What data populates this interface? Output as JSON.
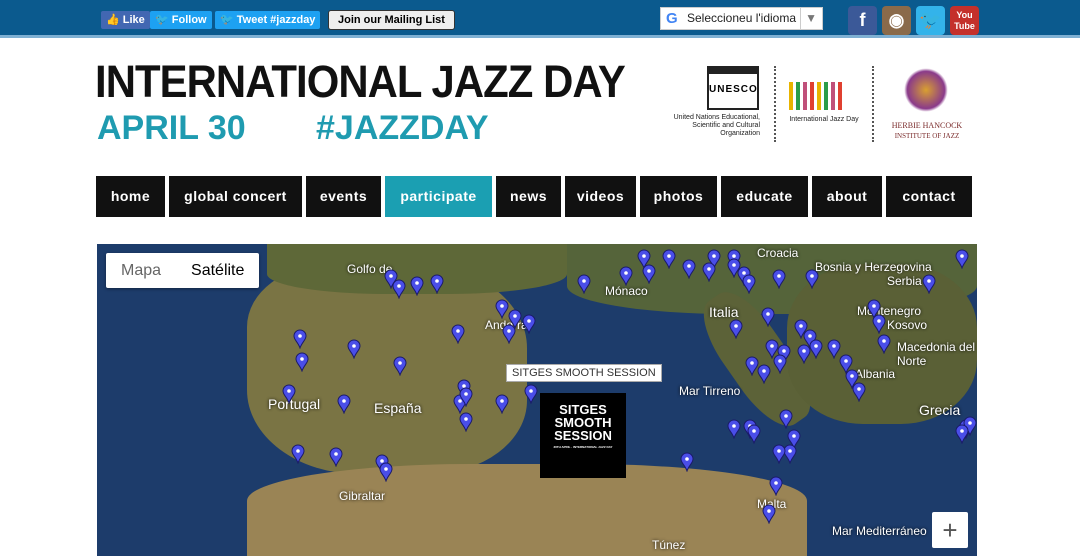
{
  "topbar": {
    "like": "Like",
    "follow": "Follow",
    "tweet": "Tweet #jazzday",
    "mailing": "Join our Mailing List",
    "language": "Seleccioneu l'idioma",
    "social": [
      "facebook-icon",
      "instagram-icon",
      "twitter-icon",
      "youtube-icon"
    ],
    "youtube_text": "You Tube"
  },
  "header": {
    "title": "INTERNATIONAL JAZZ DAY",
    "date": "APRIL 30",
    "hashtag": "#JAZZDAY",
    "unesco": "UNESCO",
    "unesco_caption": "United Nations Educational, Scientific and Cultural Organization",
    "ijd_caption": "International Jazz Day",
    "hhij_name": "Herbie Hancock",
    "hhij_sub": "Institute of Jazz"
  },
  "nav": [
    {
      "label": "home"
    },
    {
      "label": "global concert"
    },
    {
      "label": "events"
    },
    {
      "label": "participate",
      "active": true
    },
    {
      "label": "news"
    },
    {
      "label": "videos"
    },
    {
      "label": "photos"
    },
    {
      "label": "educate"
    },
    {
      "label": "about"
    },
    {
      "label": "contact"
    }
  ],
  "map": {
    "type_map": "Mapa",
    "type_satellite": "Satélite",
    "tooltip": "SITGES SMOOTH SESSION",
    "poster_title": "SITGES SMOOTH SESSION",
    "poster_sub": "30TH APRIL · INTERNATIONAL JAZZ DAY",
    "zoom_in": "+",
    "labels": [
      "Golfo de",
      "Croacia",
      "Bosnia y Herzegovina",
      "Serbia",
      "Mónaco",
      "Andorra",
      "Italia",
      "Montenegro",
      "Kosovo",
      "Macedonia del Norte",
      "Albania",
      "Portugal",
      "España",
      "Mar Tirreno",
      "Grecia",
      "Gibraltar",
      "Malta",
      "Mar Mediterráneo",
      "Túnez"
    ]
  },
  "colors": {
    "accent": "#1b9fb2",
    "topbar": "#0b5a8e",
    "marker": "#4a4ee8"
  }
}
